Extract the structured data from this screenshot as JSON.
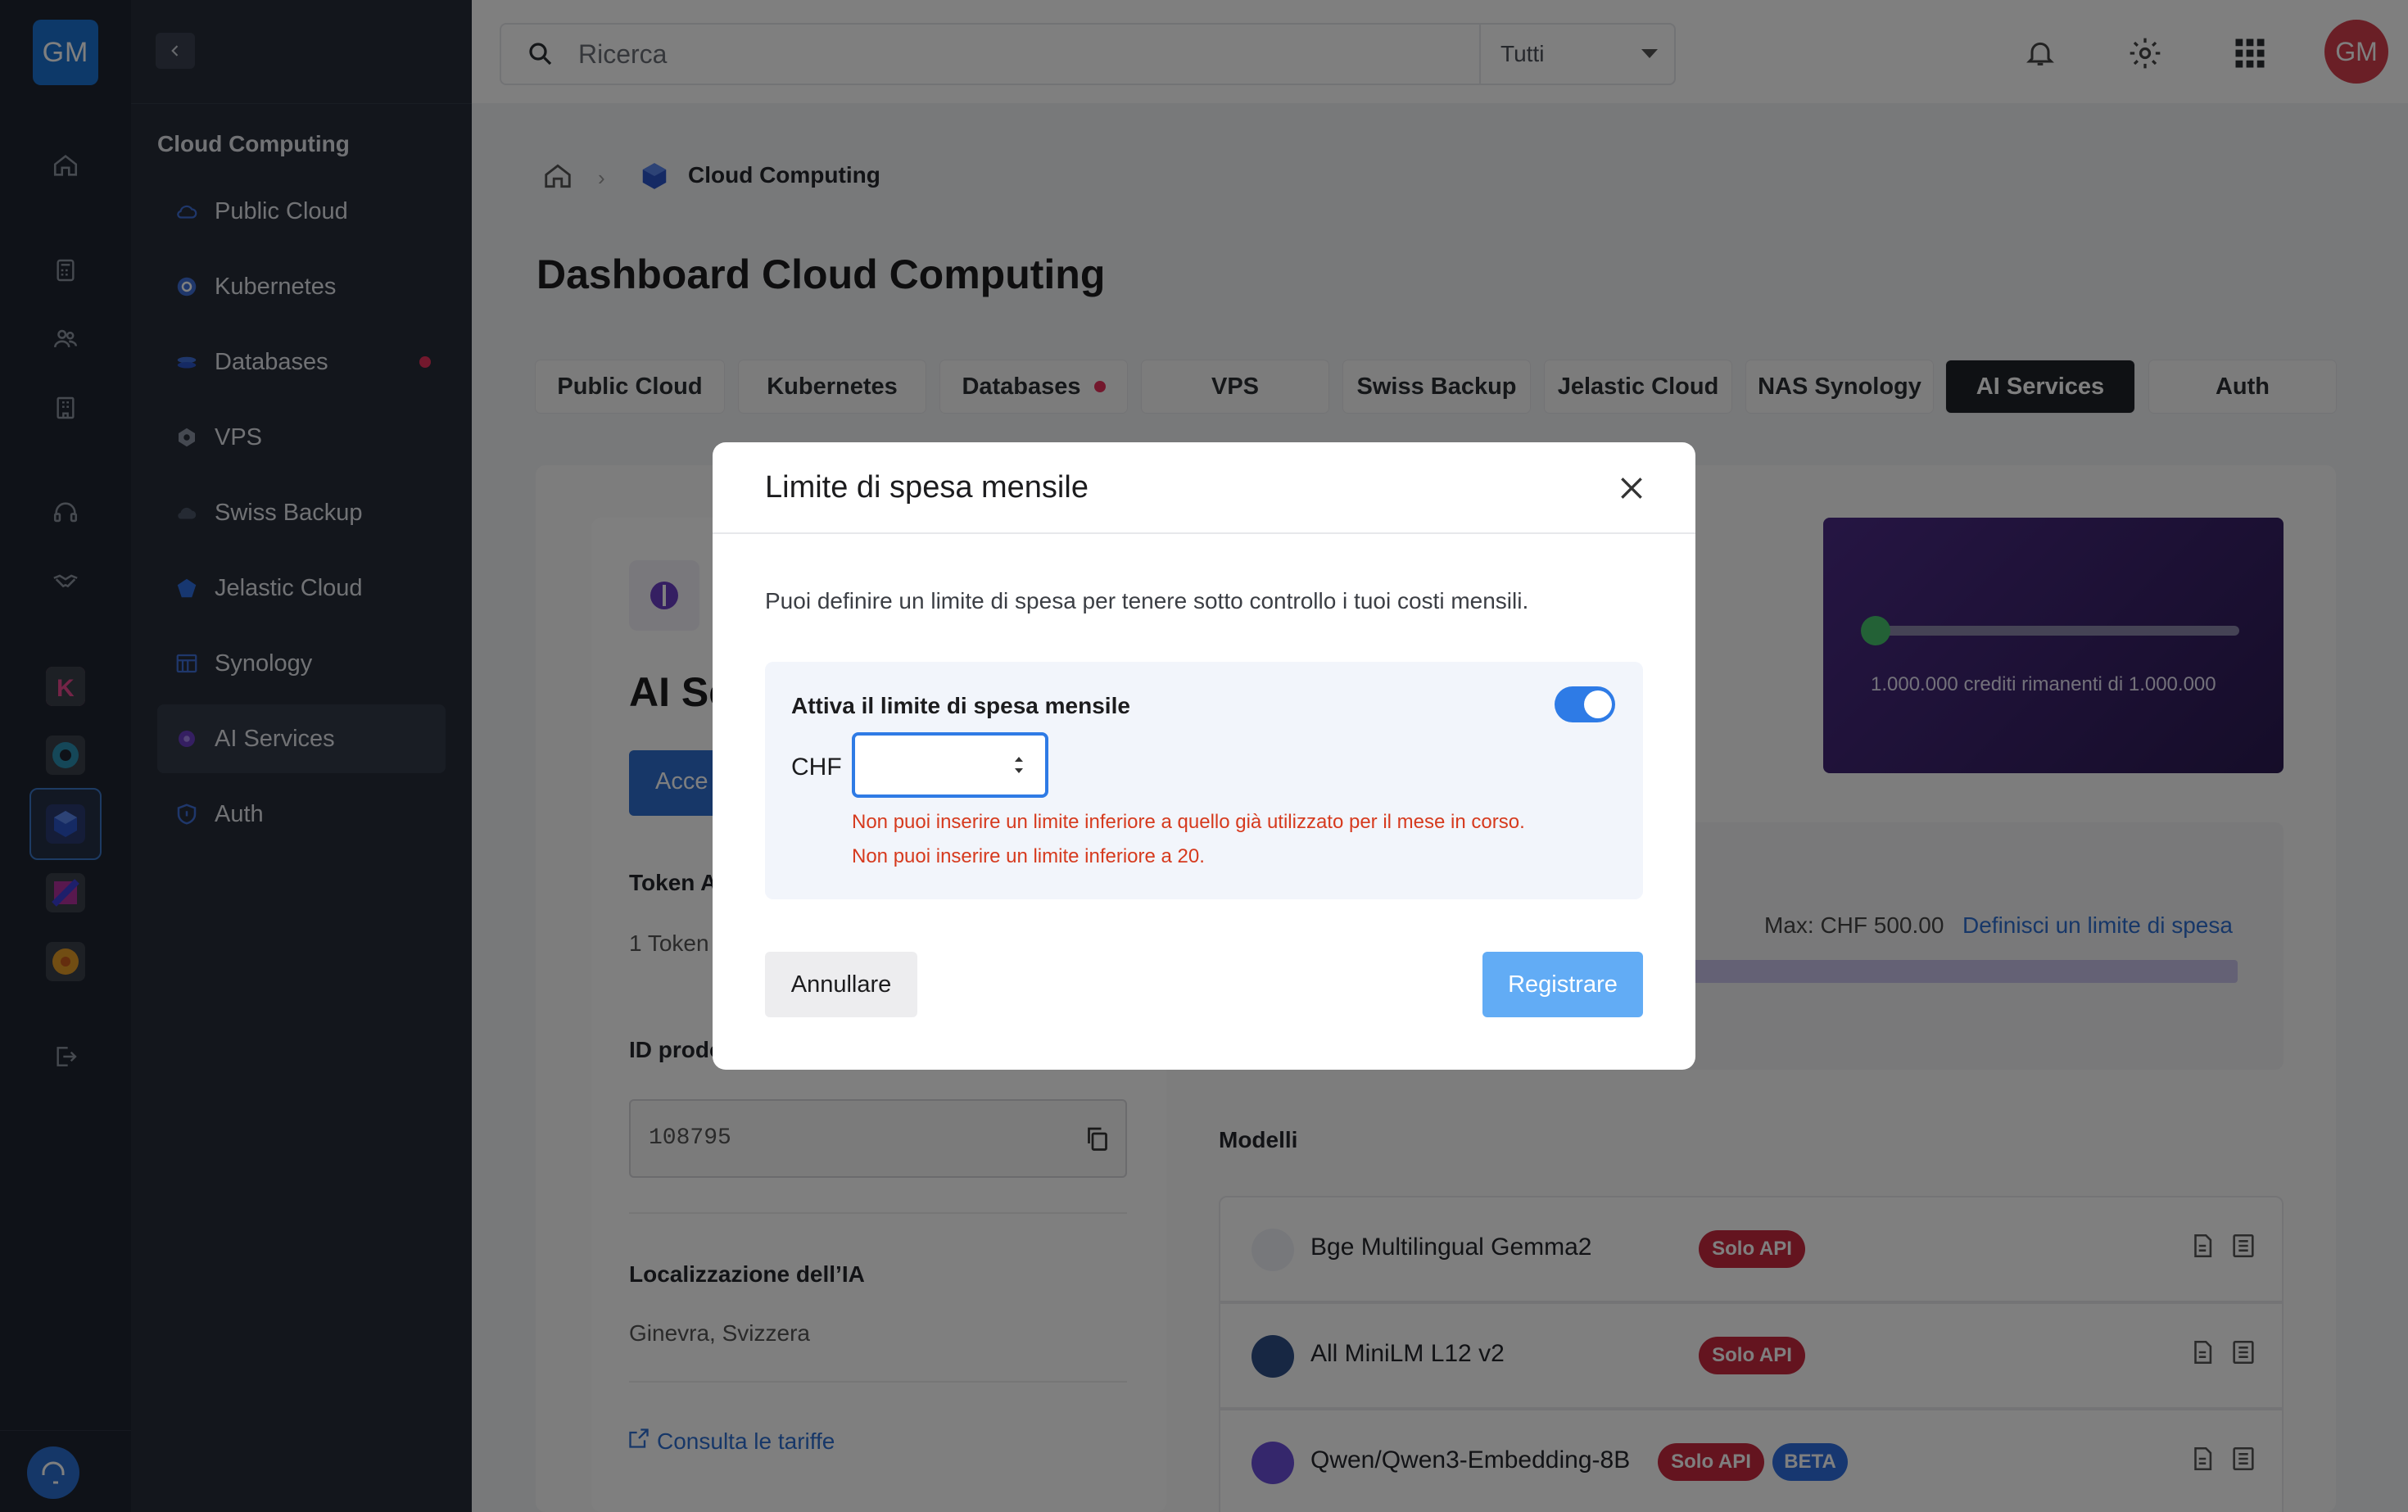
{
  "app": {
    "avatar_initials": "GM",
    "logo_text": "GM"
  },
  "rail": {
    "icons": [
      "home-icon",
      "calculator-icon",
      "users-icon",
      "building-icon",
      "headset-icon",
      "handshake-icon"
    ],
    "apps": [
      "kubernetes-app",
      "app-2",
      "cloud-computing-app",
      "app-4",
      "app-5"
    ]
  },
  "sidebar": {
    "section_title": "Cloud Computing",
    "items": [
      {
        "label": "Public Cloud",
        "icon": "cloud-icon"
      },
      {
        "label": "Kubernetes",
        "icon": "kubernetes-icon"
      },
      {
        "label": "Databases",
        "icon": "database-icon",
        "dot": true
      },
      {
        "label": "VPS",
        "icon": "vps-icon"
      },
      {
        "label": "Swiss Backup",
        "icon": "backup-cloud-icon"
      },
      {
        "label": "Jelastic Cloud",
        "icon": "jelastic-icon"
      },
      {
        "label": "Synology",
        "icon": "synology-icon"
      },
      {
        "label": "AI Services",
        "icon": "ai-icon",
        "active": true
      },
      {
        "label": "Auth",
        "icon": "shield-icon"
      }
    ]
  },
  "topbar": {
    "search_placeholder": "Ricerca",
    "filter_value": "Tutti"
  },
  "breadcrumb": {
    "current": "Cloud Computing"
  },
  "page": {
    "title": "Dashboard Cloud Computing",
    "tabs": [
      "Public Cloud",
      "Kubernetes",
      "Databases",
      "VPS",
      "Swiss Backup",
      "Jelastic Cloud",
      "NAS Synology",
      "AI Services",
      "Auth"
    ],
    "active_tab": "AI Services"
  },
  "product": {
    "title_partial": "AI Se",
    "button_partial": "Acce",
    "token_label": "Token A",
    "token_value": "1 Token",
    "id_label": "ID prodo",
    "id_value": "108795",
    "location_label": "Localizzazione dell’IA",
    "location_value": "Ginevra, Svizzera",
    "tariffs_link": "Consulta le tariffe"
  },
  "credits": {
    "text": "1.000.000 crediti rimanenti di 1.000.000",
    "fraction_used": 0.0
  },
  "spending": {
    "max_label": "Max: CHF 500.00",
    "define_link": "Definisci un limite di spesa"
  },
  "models": {
    "title": "Modelli",
    "items": [
      {
        "name": "Bge Multilingual Gemma2",
        "badges": [
          "Solo API"
        ]
      },
      {
        "name": "All MiniLM L12 v2",
        "badges": [
          "Solo API"
        ]
      },
      {
        "name": "Qwen/Qwen3-Embedding-8B",
        "badges": [
          "Solo API",
          "BETA"
        ]
      }
    ]
  },
  "modal": {
    "title": "Limite di spesa mensile",
    "description": "Puoi definire un limite di spesa per tenere sotto controllo i tuoi costi mensili.",
    "toggle_label": "Attiva il limite di spesa mensile",
    "toggle_on": true,
    "currency": "CHF",
    "input_value": "",
    "errors": [
      "Non puoi inserire un limite inferiore a quello già utilizzato per il mese in corso.",
      "Non puoi inserire un limite inferiore a 20."
    ],
    "cancel": "Annullare",
    "save": "Registrare"
  },
  "colors": {
    "accent": "#2e7be6",
    "error": "#d63a1e",
    "badge_red": "#c8283e",
    "badge_blue": "#2e6fe0",
    "purple_start": "#4b2b86",
    "purple_end": "#2b1a52"
  }
}
